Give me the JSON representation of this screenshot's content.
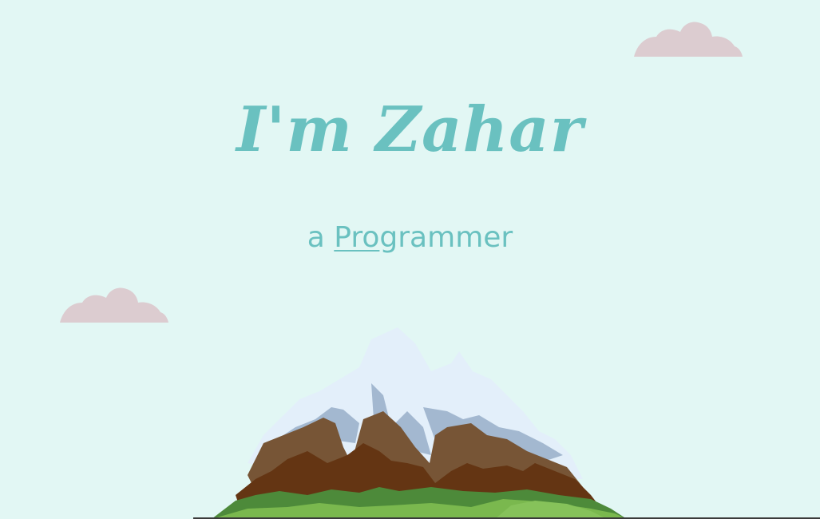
{
  "hero": {
    "title": "I'm Zahar",
    "subtitle_prefix": "a",
    "role_underlined": "Pro",
    "role_rest": "grammer"
  },
  "colors": {
    "background": "#e2f7f4",
    "accent": "#6ac1c0",
    "cloud": "#dcccd0",
    "snow": "#e3effa",
    "snow_shadow": "#a3b8d0",
    "rock_light": "#775536",
    "rock_dark": "#643513",
    "grass_dark": "#4d8a3a",
    "grass_light": "#7ab84e"
  },
  "icons": [
    "cloud-icon",
    "mountain-illustration"
  ]
}
